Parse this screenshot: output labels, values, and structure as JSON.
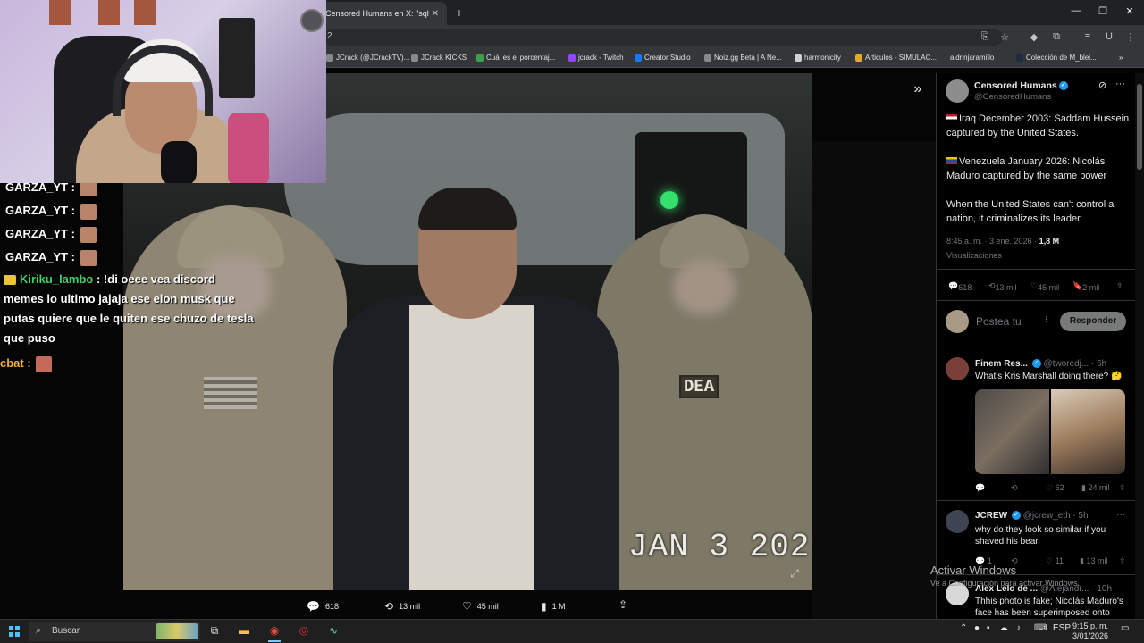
{
  "browser": {
    "tab_title": "Censored Humans en X: \"sqlrac",
    "url_fragment": "2",
    "bookmarks": [
      "JCrack (@JCrackTV)...",
      "JCrack KICKS",
      "Cuál es el porcentaj...",
      "jcrack - Twitch",
      "Creator Studio",
      "Noiz.gg Beta | A Ne...",
      "harmonicity",
      "Articulos - SIMULAC...",
      "aldrinjaramillo",
      "Colección de M_blei..."
    ]
  },
  "chat": {
    "repeated_user": "GARZA_YT :",
    "kiriku_user": "Kiriku_lambo",
    "kiriku_message": ": !di oeee vea discord memes lo ultimo jajaja ese elon musk que putas quiere que le quiten ese chuzo de tesla que puso",
    "cbat_user": "cbat :"
  },
  "media": {
    "patch_text": "DEA",
    "timestamp_text": "JAN 3 202",
    "actions": {
      "replies": "618",
      "reposts": "13 mil",
      "likes": "45 mil",
      "views": "1 M"
    }
  },
  "post": {
    "author_name": "Censored Humans",
    "author_handle": "@CensoredHumans",
    "paragraph1": "Iraq December 2003: Saddam Hussein captured by the United States.",
    "paragraph2": "Venezuela January 2026: Nicolás Maduro captured by the same power",
    "paragraph3": "When the United States can't control a nation, it criminalizes its leader.",
    "time": "8:45 a. m. · 3 ene. 2026 ·",
    "views_count": "1,8 M",
    "views_label": "Visualizaciones",
    "stats": {
      "replies": "618",
      "reposts": "13 mil",
      "likes": "45 mil",
      "bookmarks": "2 mil"
    },
    "reply_placeholder": "Postea tu",
    "reply_button": "Responder"
  },
  "replies": [
    {
      "name": "Finem Res...",
      "handle": "@tworedj...",
      "time": "· 6h",
      "text": "What's Kris Marshall doing there? 🤔",
      "likes": "62",
      "views": "24 mil"
    },
    {
      "name": "JCREW",
      "handle": "@jcrew_eth",
      "time": "· 5h",
      "text": "why do they look so similar if you shaved his bear",
      "replies": "1",
      "likes": "11",
      "views": "13 mil"
    },
    {
      "name": "Alex Lelo de ...",
      "handle": "@Alejandr...",
      "time": "· 10h",
      "text": "Thhis photo is fake; Nicolás Maduro's face has been superimposed onto"
    }
  ],
  "windows": {
    "activate_title": "Activar Windows",
    "activate_sub": "Ve a Configuración para activar Windows.",
    "search_label": "Buscar",
    "language": "ESP",
    "time": "9:15 p. m.",
    "date": "3/01/2026"
  },
  "colors": {
    "x_blue": "#1d9bf0",
    "kiriku_green": "#3dd16a",
    "cbat_orange": "#f0b134",
    "gold_badge": "#e8c43a"
  }
}
